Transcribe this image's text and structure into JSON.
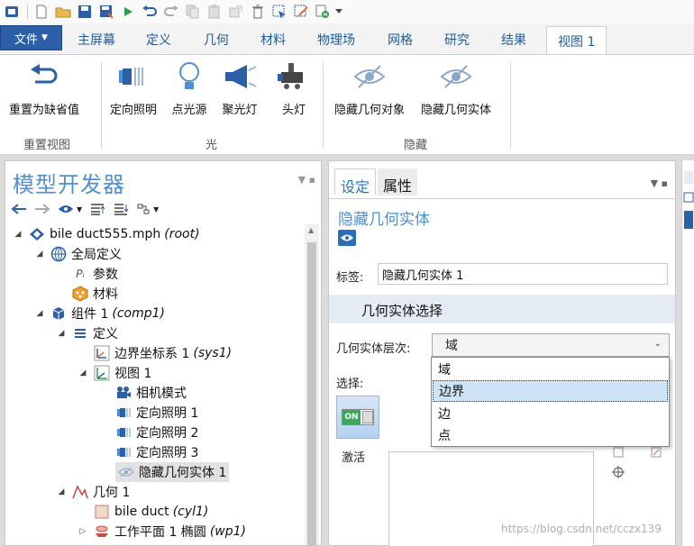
{
  "quick_access": {
    "items": [
      "app-icon",
      "new-icon",
      "open-icon",
      "save-icon",
      "save-as-icon",
      "run-icon",
      "undo-icon",
      "redo-icon",
      "copy-icon",
      "paste-icon",
      "duplicate-icon",
      "delete-icon",
      "select-icon",
      "clear-icon",
      "zoom-icon",
      "more-icon"
    ]
  },
  "ribbon_tabs": {
    "file": "文件",
    "tabs": [
      "主屏幕",
      "定义",
      "几何",
      "材料",
      "物理场",
      "网格",
      "研究",
      "结果"
    ],
    "active": "视图 1"
  },
  "ribbon": {
    "reset_view": "重置为缺省值",
    "group_reset_view": "重置视图",
    "directional_light": "定向照明",
    "point_light": "点光源",
    "spotlight": "聚光灯",
    "headlight": "头灯",
    "group_light": "光",
    "hide_geometry_objects": "隐藏几何对象",
    "hide_geometric_entities": "隐藏几何实体",
    "group_hide": "隐藏"
  },
  "model_builder": {
    "title": "模型开发器",
    "tree": {
      "root": {
        "label": "bile duct555.mph",
        "tag": "(root)"
      },
      "global_defs": "全局定义",
      "parameters": "参数",
      "materials": "材料",
      "component": {
        "label": "组件 1",
        "tag": "(comp1)"
      },
      "definitions": "定义",
      "boundary_system": {
        "label": "边界坐标系 1",
        "tag": "(sys1)"
      },
      "view": "视图 1",
      "camera": "相机模式",
      "dir_light_1": "定向照明 1",
      "dir_light_2": "定向照明 2",
      "dir_light_3": "定向照明 3",
      "hide_entities_1": "隐藏几何实体 1",
      "geometry": "几何 1",
      "bile_duct": {
        "label": "bile duct",
        "tag": "(cyl1)"
      },
      "work_plane": {
        "label": "工作平面 1 椭圆",
        "tag": "(wp1)"
      }
    }
  },
  "settings": {
    "tab_settings": "设定",
    "tab_properties": "属性",
    "heading": "隐藏几何实体",
    "label_caption": "标签:",
    "label_value": "隐藏几何实体 1",
    "section_title": "几何实体选择",
    "level_caption": "几何实体层次:",
    "level_value": "域",
    "selection_caption": "选择:",
    "toggle_text": "ON",
    "activate": "激活"
  },
  "dropdown": {
    "options": [
      "域",
      "边界",
      "边",
      "点"
    ],
    "highlighted_index": 1
  },
  "watermark": "https://blog.csdn.net/cczx139",
  "colors": {
    "accent": "#2b5fa8",
    "link_blue": "#1f5c9c",
    "title_blue": "#4d8fd4",
    "section_bg": "#e4ebf4"
  }
}
